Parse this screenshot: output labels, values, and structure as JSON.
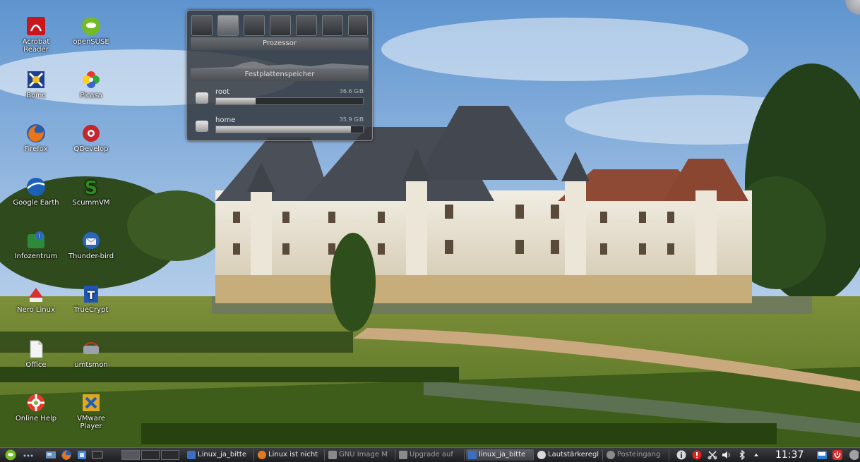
{
  "desktop": {
    "icons": [
      {
        "id": "acrobat-reader",
        "label": "Acrobat Reader",
        "icon": "acrobat-icon"
      },
      {
        "id": "opensuse",
        "label": "openSUSE",
        "icon": "opensuse-icon"
      },
      {
        "id": "boinc",
        "label": "Boinc",
        "icon": "boinc-icon"
      },
      {
        "id": "picasa",
        "label": "Picasa",
        "icon": "picasa-icon"
      },
      {
        "id": "firefox",
        "label": "Firefox",
        "icon": "firefox-icon"
      },
      {
        "id": "qdevelop",
        "label": "QDevelop",
        "icon": "qdevelop-icon"
      },
      {
        "id": "google-earth",
        "label": "Google Earth",
        "icon": "google-earth-icon"
      },
      {
        "id": "scummvm",
        "label": "ScummVM",
        "icon": "scummvm-icon"
      },
      {
        "id": "infozentrum",
        "label": "Infozentrum",
        "icon": "info-icon"
      },
      {
        "id": "thunderbird",
        "label": "Thunder-bird",
        "icon": "thunderbird-icon"
      },
      {
        "id": "nero-linux",
        "label": "Nero Linux",
        "icon": "nero-icon"
      },
      {
        "id": "truecrypt",
        "label": "TrueCrypt",
        "icon": "truecrypt-icon"
      },
      {
        "id": "office",
        "label": "Office",
        "icon": "document-icon"
      },
      {
        "id": "umtsmon",
        "label": "umtsmon",
        "icon": "umtsmon-icon"
      },
      {
        "id": "online-help",
        "label": "Online Help",
        "icon": "help-lifebuoy-icon"
      },
      {
        "id": "vmware-player",
        "label": "VMware Player",
        "icon": "vmware-icon"
      }
    ]
  },
  "sysmon": {
    "sections": {
      "cpu": "Prozessor",
      "disk": "Festplattenspeicher"
    },
    "disks": [
      {
        "name": "root",
        "size": "36.6 GiB",
        "usage": 0.27
      },
      {
        "name": "home",
        "size": "35.9 GiB",
        "usage": 0.92
      }
    ]
  },
  "taskbar": {
    "tasks": [
      {
        "label": "Linux_ja_bitte",
        "state": "normal",
        "color": "#3b6fbf"
      },
      {
        "label": "Linux ist nicht",
        "state": "normal",
        "color": "#e07a1f"
      },
      {
        "label": "GNU Image M",
        "state": "dim",
        "color": "#8a8a8a"
      },
      {
        "label": "Upgrade auf",
        "state": "dim",
        "color": "#8a8a8a"
      },
      {
        "label": "linux_ja_bitte",
        "state": "active",
        "color": "#3b6fbf"
      },
      {
        "label": "Lautstärkeregl",
        "state": "normal",
        "color": "#d9d9d9"
      },
      {
        "label": "Posteingang",
        "state": "dim",
        "color": "#8a8a8a"
      }
    ],
    "clock": "11:37"
  },
  "colors": {
    "panel_dark": "#1c1d20",
    "opensuse_green": "#73ba25",
    "acrobat_red": "#c8161d"
  }
}
